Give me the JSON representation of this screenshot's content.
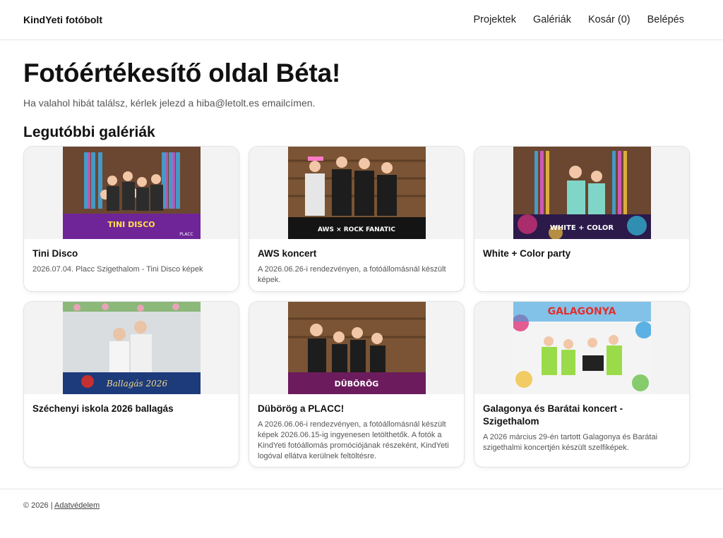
{
  "navbar": {
    "brand": "KindYeti fotóbolt",
    "links": [
      "Projektek",
      "Galériák",
      "Kosár (0)",
      "Belépés"
    ]
  },
  "hero": {
    "title": "Fotóértékesítő oldal Béta!",
    "subtitle": "Ha valahol hibát találsz, kérlek jelezd a hiba@letolt.es emailcímen."
  },
  "section_title": "Legutóbbi galériák",
  "galleries": [
    {
      "title": "Tini Disco",
      "text": "2026.07.04. Placc Szigethalom - Tini Disco képek",
      "banner": "TINI DISCO"
    },
    {
      "title": "AWS koncert",
      "text": "A 2026.06.26-i rendezvényen, a fotóállomásnál készült képek.",
      "banner": "AWS × ROCK FANATIC"
    },
    {
      "title": "White + Color party",
      "text": "",
      "banner": "WHITE + COLOR"
    },
    {
      "title": "Széchenyi iskola 2026 ballagás",
      "text": "",
      "banner": "Ballagás 2026"
    },
    {
      "title": "Dübörög a PLACC!",
      "text": "A 2026.06.06-i rendezvényen, a fotóállomásnál készült képek 2026.06.15-ig ingyenesen letölthetők. A fotók a KindYeti fotóállomás promóciójának részeként, KindYeti logóval ellátva kerülnek feltöltésre.",
      "banner": "DÜBÖRÖG"
    },
    {
      "title": "Galagonya és Barátai koncert - Szigethalom",
      "text": "A 2026 március 29-én tartott Galagonya és Barátai szigethalmi koncertjén készült szelfiképek.",
      "banner": "GALAGONYA"
    }
  ],
  "footer": {
    "copyright": "© 2026 |",
    "privacy_link": "Adatvédelem"
  }
}
